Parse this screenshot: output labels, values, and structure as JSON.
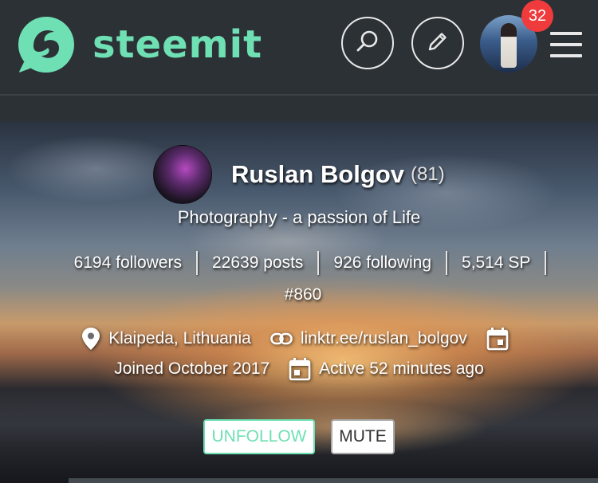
{
  "header": {
    "brand": "steemit",
    "notification_count": "32",
    "icons": {
      "logo": "steemit-logo-icon",
      "search": "search-icon",
      "edit": "pencil-icon",
      "menu": "hamburger-menu-icon"
    },
    "colors": {
      "brand": "#6fe0b3",
      "badge": "#ef3b3b",
      "background": "#2c3136"
    }
  },
  "profile": {
    "name": "Ruslan Bolgov",
    "reputation": "(81)",
    "tagline": "Photography - a passion of Life",
    "stats": {
      "followers": "6194 followers",
      "posts": "22639 posts",
      "following": "926 following",
      "sp": "5,514 SP",
      "rank": "#860"
    },
    "location": "Klaipeda, Lithuania",
    "website": "linktr.ee/ruslan_bolgov",
    "joined": "Joined October 2017",
    "active": "Active 52 minutes ago",
    "icons": {
      "location": "map-pin-icon",
      "website": "link-icon",
      "joined": "calendar-icon",
      "active": "calendar-icon"
    }
  },
  "actions": {
    "unfollow_label": "UNFOLLOW",
    "mute_label": "MUTE"
  }
}
